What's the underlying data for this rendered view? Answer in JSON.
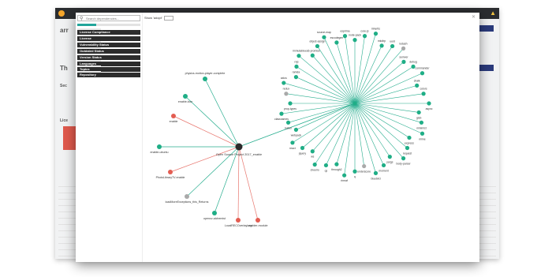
{
  "app": {
    "brand": "",
    "notifications_icon": "bell-icon"
  },
  "background": {
    "labels": [
      "arr",
      "Th",
      "Sec",
      "Lice"
    ],
    "button_label": "",
    "rows": 12
  },
  "modal": {
    "search": {
      "placeholder": "Search dependencies..."
    },
    "toggle_label": "Show 'adopt'",
    "close_icon": "close-icon",
    "filters": [
      "License Compliance",
      "License",
      "Vulnerability Status",
      "Outdated Status",
      "Version Status",
      "Languages",
      "Topics",
      "Repository"
    ]
  },
  "graph": {
    "colors": {
      "edge_ok": "#27ad8e",
      "edge_bad": "#e8776f",
      "node_ok": "#1fae86",
      "node_bad": "#e35d52",
      "node_unknown": "#a9a9a9",
      "root": "#2a2a2a"
    },
    "root_label": "Open Source Project 2017_enable",
    "left_nodes": [
      {
        "label": "physics-motion-player-complete",
        "status": "ok"
      },
      {
        "label": "enable-tour",
        "status": "ok"
      },
      {
        "label": "enable",
        "status": "bad"
      },
      {
        "label": "enable-ubuntu",
        "status": "ok"
      },
      {
        "label": "PhotoLibraryTV-enable",
        "status": "bad"
      },
      {
        "label": "loadMoreExceptions_this_Returns",
        "status": "unknown"
      },
      {
        "label": "opencv-alchemist",
        "status": "ok"
      },
      {
        "label": "LocalRECOverlayLog",
        "status": "bad"
      },
      {
        "label": "enabler-module",
        "status": "bad"
      }
    ],
    "hub_nodes": [
      {
        "label": "node-pack",
        "status": "ok"
      },
      {
        "label": "core-js",
        "status": "ok"
      },
      {
        "label": "inherits",
        "status": "ok"
      },
      {
        "label": "mkdirp",
        "status": "ok"
      },
      {
        "label": "uuid",
        "status": "ok"
      },
      {
        "label": "lodash",
        "status": "unknown"
      },
      {
        "label": "semver",
        "status": "ok"
      },
      {
        "label": "debug",
        "status": "ok"
      },
      {
        "label": "commander",
        "status": "ok"
      },
      {
        "label": "chalk",
        "status": "ok"
      },
      {
        "label": "colors",
        "status": "ok"
      },
      {
        "label": "async",
        "status": "ok"
      },
      {
        "label": "glob",
        "status": "ok"
      },
      {
        "label": "minimist",
        "status": "ok"
      },
      {
        "label": "mime",
        "status": "ok"
      },
      {
        "label": "express",
        "status": "ok"
      },
      {
        "label": "request",
        "status": "ok"
      },
      {
        "label": "body-parser",
        "status": "ok"
      },
      {
        "label": "yargs",
        "status": "ok"
      },
      {
        "label": "moment",
        "status": "ok"
      },
      {
        "label": "bluebird",
        "status": "ok"
      },
      {
        "label": "underscore",
        "status": "unknown"
      },
      {
        "label": "q",
        "status": "ok"
      },
      {
        "label": "rimraf",
        "status": "ok"
      },
      {
        "label": "through2",
        "status": "ok"
      },
      {
        "label": "qs",
        "status": "ok"
      },
      {
        "label": "cheerio",
        "status": "ok"
      },
      {
        "label": "ws",
        "status": "ok"
      },
      {
        "label": "jquery",
        "status": "ok"
      },
      {
        "label": "react",
        "status": "ok"
      },
      {
        "label": "webpack",
        "status": "ok"
      },
      {
        "label": "babel",
        "status": "ok"
      },
      {
        "label": "classnames",
        "status": "ok"
      },
      {
        "label": "prop-types",
        "status": "ok"
      },
      {
        "label": "redux",
        "status": "unknown"
      },
      {
        "label": "axios",
        "status": "ok"
      },
      {
        "label": "ramda",
        "status": "ok"
      },
      {
        "label": "rxjs",
        "status": "ok"
      },
      {
        "label": "immutable",
        "status": "ok"
      },
      {
        "label": "es6-promise",
        "status": "ok"
      },
      {
        "label": "object-assign",
        "status": "ok"
      },
      {
        "label": "source-map",
        "status": "ok"
      },
      {
        "label": "escodegen",
        "status": "ok"
      },
      {
        "label": "esprima",
        "status": "ok"
      }
    ]
  }
}
